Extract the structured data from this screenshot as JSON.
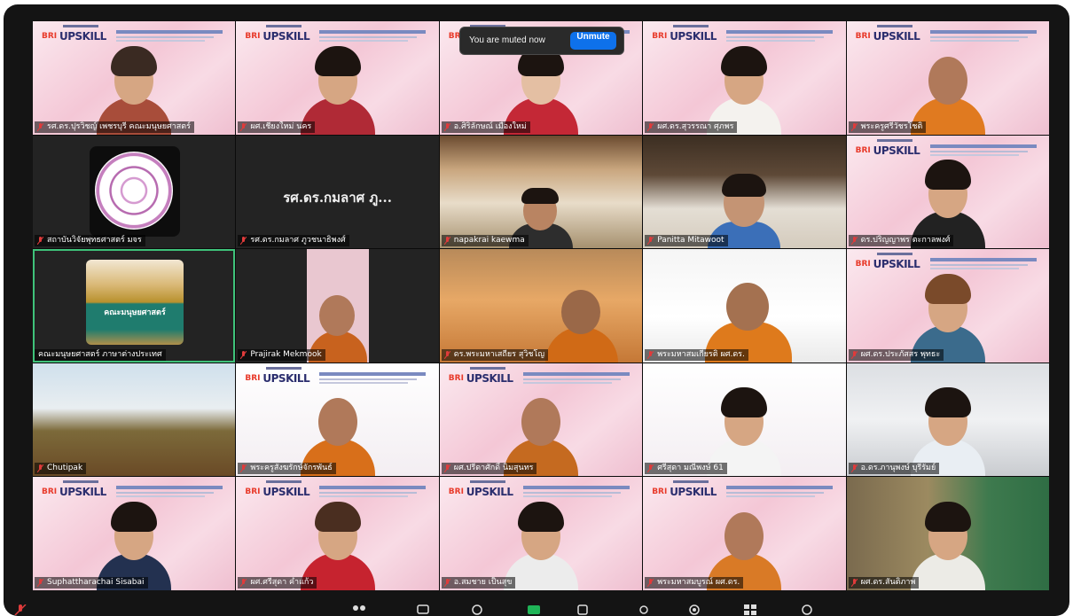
{
  "notice": {
    "message": "You are muted now",
    "button": "Unmute"
  },
  "banner": {
    "logo_left": "BRI",
    "logo_right": "UPSKILL"
  },
  "tiles": [
    {
      "name": "รศ.ดร.ปุรวิชญ์ เพชรบุรี คณะมนุษยศาสตร์"
    },
    {
      "name": "ผศ.เชียงใหม่ นคร"
    },
    {
      "name": "อ.ศิริลักษณ์ เมืองใหม่"
    },
    {
      "name": "ผศ.ดร.สุวรรณา ศุภพร"
    },
    {
      "name": "พระครูศรีวัชรโชติ"
    },
    {
      "name": "สถาบันวิจัยพุทธศาสตร์ มจร",
      "sub": ""
    },
    {
      "name": "รศ.ดร.กมลาศ ภูวชนาธิพงศ์",
      "big": "รศ.ดร.กมลาศ ภู..."
    },
    {
      "name": "napakrai kaewma"
    },
    {
      "name": "Panitta Mitawoot"
    },
    {
      "name": "ดร.ปริญญาพร ตะกาลพงศ์"
    },
    {
      "name": "คณะมนุษยศาสตร์ ภาษาต่างประเทศ",
      "sign": "คณะมนุษยศาสตร์"
    },
    {
      "name": "Prajirak Mekmook"
    },
    {
      "name": "ดร.พระมหาเสถียร สุวิชโญ"
    },
    {
      "name": "พระมหาสมเกียรติ ผศ.ดร."
    },
    {
      "name": "ผศ.ดร.ประภัสสร พุทธะ"
    },
    {
      "name": "Chutipak"
    },
    {
      "name": "พระครูสังฆรักษ์จักรพันธ์"
    },
    {
      "name": "ผศ.ปรีดาศักดิ์ นิ่มสุนทร"
    },
    {
      "name": "ศรีสุดา มณีพงษ์ 61"
    },
    {
      "name": "อ.ดร.ภานุพงษ์ บุรีรัมย์"
    },
    {
      "name": "Suphattharachai Sisabai"
    },
    {
      "name": "ผศ.ศรีสุดา คำแก้ว"
    },
    {
      "name": "อ.สมชาย เป็นสุข"
    },
    {
      "name": "พระมหาสมบูรณ์ ผศ.ดร."
    },
    {
      "name": "ผศ.ดร.สันติภาพ"
    }
  ],
  "colors": {
    "accent_blue": "#0e71eb",
    "active_speaker": "#3fc27a",
    "frame": "#141414"
  }
}
